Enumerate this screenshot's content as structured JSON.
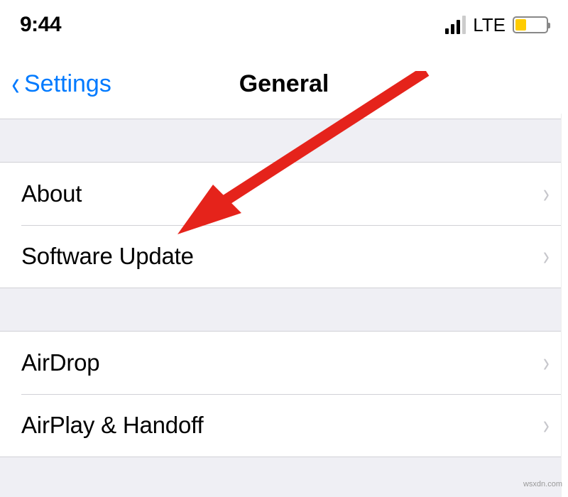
{
  "status": {
    "time": "9:44",
    "network_label": "LTE"
  },
  "nav": {
    "back_label": "Settings",
    "title": "General"
  },
  "section1": {
    "items": [
      {
        "label": "About"
      },
      {
        "label": "Software Update"
      }
    ]
  },
  "section2": {
    "items": [
      {
        "label": "AirDrop"
      },
      {
        "label": "AirPlay & Handoff"
      }
    ]
  },
  "watermark": "wsxdn.com"
}
